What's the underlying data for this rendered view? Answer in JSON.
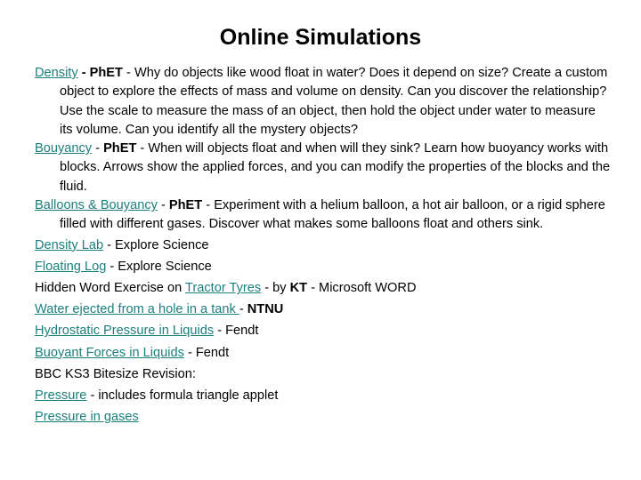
{
  "slide": {
    "title": "Online Simulations",
    "background_color": "#ffffff",
    "text_color": "#000000",
    "link_color": "#1d7e7e"
  },
  "entries": {
    "density": {
      "link": "Density",
      "sep1": " - ",
      "source": "PhET",
      "sep2": " - ",
      "description": "Why do objects like wood float in water? Does it depend on size? Create a custom object to explore the effects of mass and volume on density. Can you discover the relationship? Use the scale to measure the mass of an object, then hold the object under water to measure its volume. Can you identify all the mystery objects?"
    },
    "bouyancy": {
      "link": "Bouyancy",
      "sep1": " - ",
      "source": "PhET",
      "sep2": " - ",
      "description": "When will objects float and when will they sink? Learn how buoyancy works with blocks. Arrows show the applied forces, and you can modify the properties of the blocks and the fluid."
    },
    "balloons": {
      "link": "Balloons & Bouyancy",
      "sep1": " - ",
      "source": "PhET",
      "sep2": " - ",
      "description": "Experiment with a helium balloon, a hot air balloon, or a rigid sphere filled with different gases. Discover what makes some balloons float and others sink."
    },
    "density_lab": {
      "link": "Density Lab",
      "suffix": " - Explore Science"
    },
    "floating_log": {
      "link": "Floating Log",
      "suffix": " - Explore Science"
    },
    "hidden_word": {
      "prefix": "Hidden Word Exercise on ",
      "link": "Tractor Tyres",
      "mid": " - by ",
      "author": "KT",
      "suffix": " - Microsoft WORD"
    },
    "water_ejected": {
      "link": "Water ejected from a hole in a tank ",
      "sep": "- ",
      "source": "NTNU"
    },
    "hydrostatic": {
      "link": "Hydrostatic Pressure in Liquids",
      "suffix": " - Fendt"
    },
    "buoyant_forces": {
      "link": "Buoyant Forces in Liquids",
      "suffix": " - Fendt"
    },
    "bbc_heading": {
      "text": "BBC KS3 Bitesize Revision:"
    },
    "pressure": {
      "link": "Pressure",
      "suffix": " - includes formula triangle applet"
    },
    "pressure_gases": {
      "link": "Pressure in gases"
    }
  }
}
